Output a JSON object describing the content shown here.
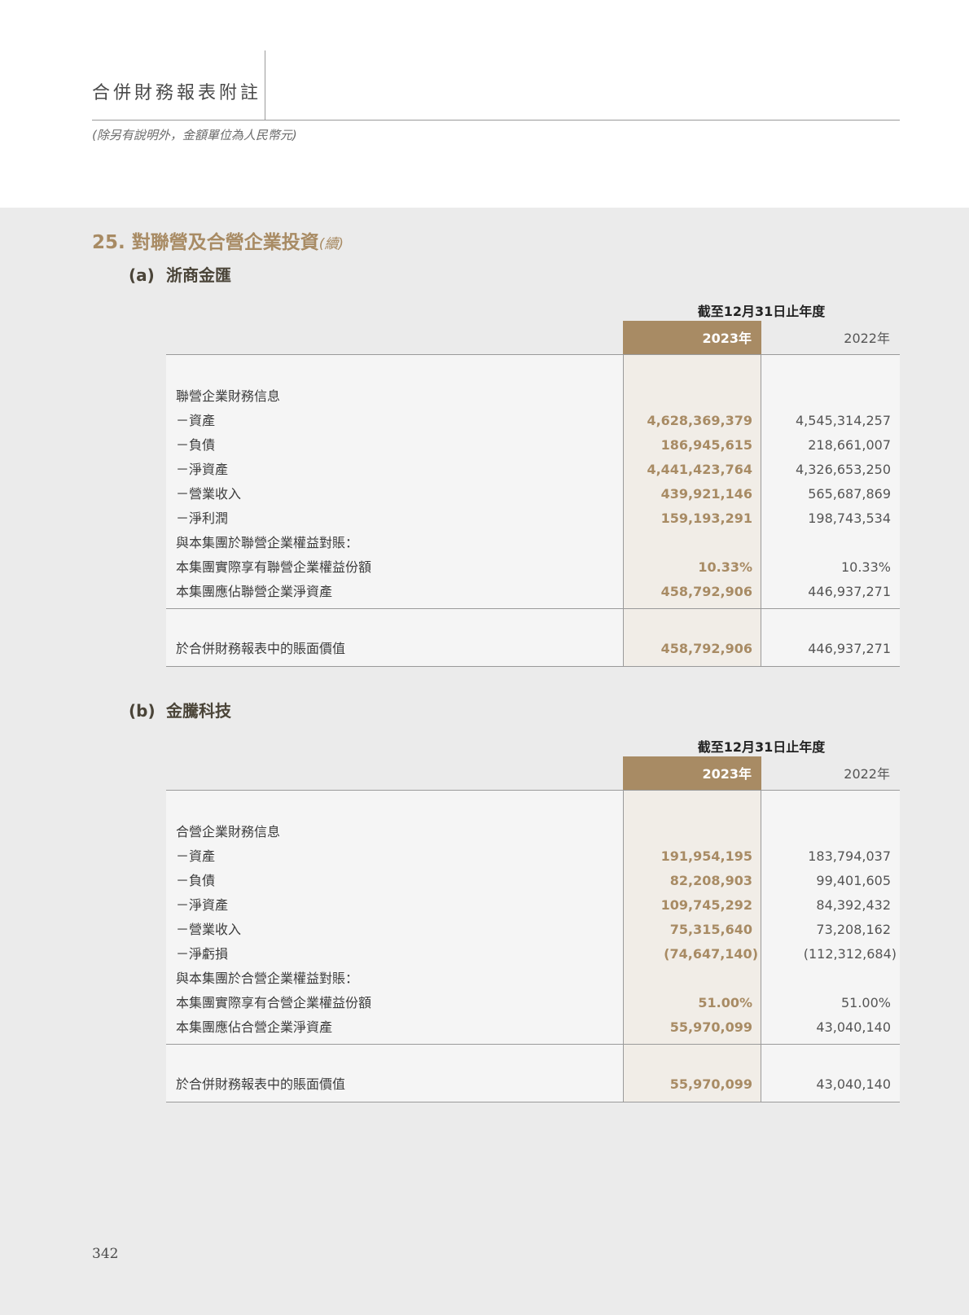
{
  "header": {
    "title": "合併財務報表附註",
    "note": "(除另有說明外，金額單位為人民幣元)"
  },
  "section": {
    "number": "25.",
    "title": "對聯營及合營企業投資",
    "continued": "(續)"
  },
  "tables": [
    {
      "letter": "(a)",
      "name": "浙商金匯",
      "period_label": "截至12月31日止年度",
      "col_2023": "2023年",
      "col_2022": "2022年",
      "rows": [
        {
          "label": "聯營企業財務信息",
          "v2023": "",
          "v2022": ""
        },
        {
          "label": "－資產",
          "v2023": "4,628,369,379",
          "v2022": "4,545,314,257"
        },
        {
          "label": "－負債",
          "v2023": "186,945,615",
          "v2022": "218,661,007"
        },
        {
          "label": "－淨資產",
          "v2023": "4,441,423,764",
          "v2022": "4,326,653,250"
        },
        {
          "label": "－營業收入",
          "v2023": "439,921,146",
          "v2022": "565,687,869"
        },
        {
          "label": "－淨利潤",
          "v2023": "159,193,291",
          "v2022": "198,743,534"
        },
        {
          "label": "與本集團於聯營企業權益對賬：",
          "v2023": "",
          "v2022": ""
        },
        {
          "label": "本集團實際享有聯營企業權益份額",
          "v2023": "10.33%",
          "v2022": "10.33%"
        },
        {
          "label": "本集團應佔聯營企業淨資產",
          "v2023": "458,792,906",
          "v2022": "446,937,271"
        }
      ],
      "total": {
        "label": "於合併財務報表中的賬面價值",
        "v2023": "458,792,906",
        "v2022": "446,937,271"
      }
    },
    {
      "letter": "(b)",
      "name": "金騰科技",
      "period_label": "截至12月31日止年度",
      "col_2023": "2023年",
      "col_2022": "2022年",
      "rows": [
        {
          "label": "合營企業財務信息",
          "v2023": "",
          "v2022": ""
        },
        {
          "label": "－資產",
          "v2023": "191,954,195",
          "v2022": "183,794,037"
        },
        {
          "label": "－負債",
          "v2023": "82,208,903",
          "v2022": "99,401,605"
        },
        {
          "label": "－淨資產",
          "v2023": "109,745,292",
          "v2022": "84,392,432"
        },
        {
          "label": "－營業收入",
          "v2023": "75,315,640",
          "v2022": "73,208,162"
        },
        {
          "label": "－淨虧損",
          "v2023": "(74,647,140)",
          "v2022": "(112,312,684)"
        },
        {
          "label": "與本集團於合營企業權益對賬：",
          "v2023": "",
          "v2022": ""
        },
        {
          "label": "本集團實際享有合營企業權益份額",
          "v2023": "51.00%",
          "v2022": "51.00%"
        },
        {
          "label": "本集團應佔合營企業淨資產",
          "v2023": "55,970,099",
          "v2022": "43,040,140"
        }
      ],
      "total": {
        "label": "於合併財務報表中的賬面價值",
        "v2023": "55,970,099",
        "v2022": "43,040,140"
      }
    }
  ],
  "page_number": "342"
}
